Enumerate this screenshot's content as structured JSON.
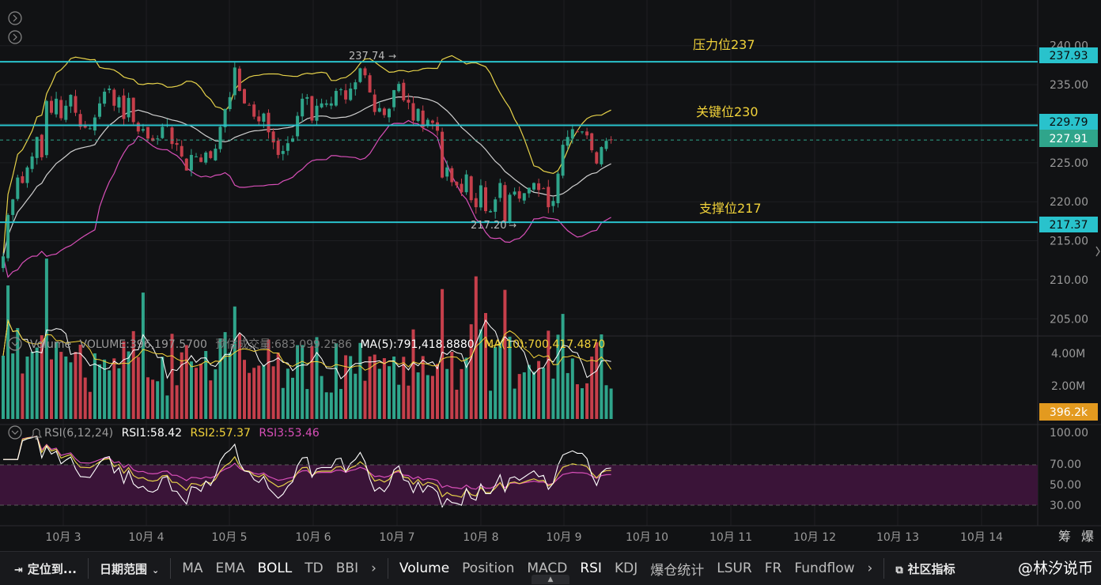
{
  "chart_data": {
    "type": "candlestick",
    "price_axis": {
      "ticks": [
        "240.00",
        "235.00",
        "230.00",
        "225.00",
        "220.00",
        "215.00",
        "210.00",
        "205.00"
      ],
      "ylim": [
        202.8,
        242.0
      ]
    },
    "x_axis": {
      "ticks": [
        "10月 3",
        "10月 4",
        "10月 5",
        "10月 6",
        "10月 7",
        "10月 8",
        "10月 9",
        "10月 10",
        "10月 11",
        "10月 12",
        "10月 13",
        "10月 14"
      ]
    },
    "candles_close": [
      213.0,
      218.3,
      220.3,
      223.1,
      222.4,
      224.4,
      225.8,
      228.3,
      225.7,
      232.9,
      231.4,
      233.2,
      230.7,
      232.3,
      233.7,
      231.4,
      229.6,
      229.5,
      229.4,
      230.8,
      232.6,
      234.1,
      234.5,
      232.3,
      233.4,
      230.6,
      233.3,
      230.2,
      229.0,
      229.3,
      228.1,
      227.8,
      228.1,
      229.6,
      229.8,
      227.4,
      227.3,
      225.8,
      224.0,
      226.0,
      225.8,
      225.1,
      226.3,
      225.6,
      226.8,
      229.6,
      231.9,
      233.4,
      237.2,
      234.2,
      232.6,
      232.4,
      230.9,
      230.3,
      231.3,
      228.9,
      227.6,
      226.0,
      226.5,
      227.5,
      228.1,
      231.0,
      233.2,
      233.4,
      230.4,
      232.3,
      232.6,
      232.6,
      232.6,
      234.2,
      234.4,
      233.1,
      234.5,
      235.3,
      237.1,
      236.2,
      234.0,
      231.5,
      232.0,
      231.1,
      231.9,
      234.3,
      235.1,
      233.0,
      232.7,
      230.4,
      231.9,
      229.5,
      230.5,
      230.1,
      229.1,
      223.1,
      224.4,
      222.5,
      222.1,
      221.2,
      223.5,
      220.2,
      219.3,
      222.1,
      218.8,
      218.8,
      220.3,
      222.4,
      217.4,
      220.9,
      221.3,
      220.4,
      221.1,
      221.8,
      222.4,
      221.5,
      221.7,
      219.3,
      220.1,
      223.6,
      227.3,
      228.3,
      229.3,
      229.0,
      229.0,
      228.5,
      226.6,
      224.9,
      227.0,
      227.8,
      227.9
    ],
    "annotations": {
      "high_marker": "237.74",
      "low_marker": "217.20",
      "lines": [
        {
          "label": "压力位237",
          "price_tag": "237.93",
          "value": 237.93
        },
        {
          "label": "关键位230",
          "price_tag": "229.79",
          "value": 229.79
        },
        {
          "label": "支撑位217",
          "price_tag": "217.37",
          "value": 217.37
        }
      ],
      "current_price_tag": "227.91",
      "current_price": 227.91
    },
    "volume_panel": {
      "legend": {
        "title": "Volume",
        "volume": "VOLUME:396,197.5700",
        "estimate": "预估成交量:683,099.2586",
        "ma5": "MA(5):791,418.8880",
        "ma10": "MA(10):700,417.4870"
      },
      "ticks": [
        "4.00M",
        "2.00M"
      ],
      "current_tag": "396.2k"
    },
    "rsi_panel": {
      "legend": {
        "title": "RSI(6,12,24)",
        "rsi1": "RSI1:58.42",
        "rsi2": "RSI2:57.37",
        "rsi3": "RSI3:53.46"
      },
      "ticks": [
        "100.00",
        "70.00",
        "50.00",
        "30.00"
      ]
    },
    "colors": {
      "background": "#111214",
      "up": "#2fa58b",
      "down": "#c63f4b",
      "boll_upper": "#e6d24a",
      "boll_mid": "#cfcfcf",
      "boll_lower": "#d84fb8",
      "level_line": "#29c2cc",
      "annotation_text": "#f2d33a",
      "rsi_band": "#3a1438"
    }
  },
  "right_buttons": {
    "left": "筹",
    "right": "爆"
  },
  "toolbar": {
    "locate": "定位到...",
    "date_range": "日期范围",
    "indicators_main": [
      "MA",
      "EMA",
      "BOLL",
      "TD",
      "BBI"
    ],
    "indicators_sub": [
      "Volume",
      "Position",
      "MACD",
      "RSI",
      "KDJ",
      "爆仓统计",
      "LSUR",
      "FR",
      "Fundflow"
    ],
    "community": "社区指标",
    "watermark": "@林汐说币"
  }
}
